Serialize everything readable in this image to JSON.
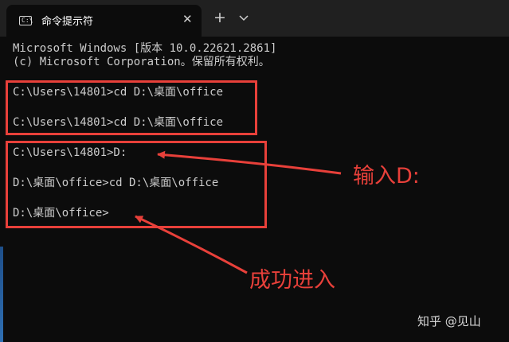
{
  "window": {
    "tab_title": "命令提示符",
    "tab_icon_glyph": "C:\\",
    "tab_icon": "terminal-icon",
    "close_icon": "close-icon",
    "new_tab_label": "+",
    "dropdown_icon": "chevron-down-icon"
  },
  "terminal": {
    "lines": [
      "Microsoft Windows [版本 10.0.22621.2861]",
      "(c) Microsoft Corporation。保留所有权利。",
      "C:\\Users\\14801>cd D:\\桌面\\office",
      "C:\\Users\\14801>cd D:\\桌面\\office",
      "C:\\Users\\14801>D:",
      "D:\\桌面\\office>cd D:\\桌面\\office",
      "D:\\桌面\\office>"
    ]
  },
  "annotations": {
    "input_label": "输入D:",
    "success_label": "成功进入",
    "color": "#e8403a"
  },
  "watermark": "知乎 @见山"
}
